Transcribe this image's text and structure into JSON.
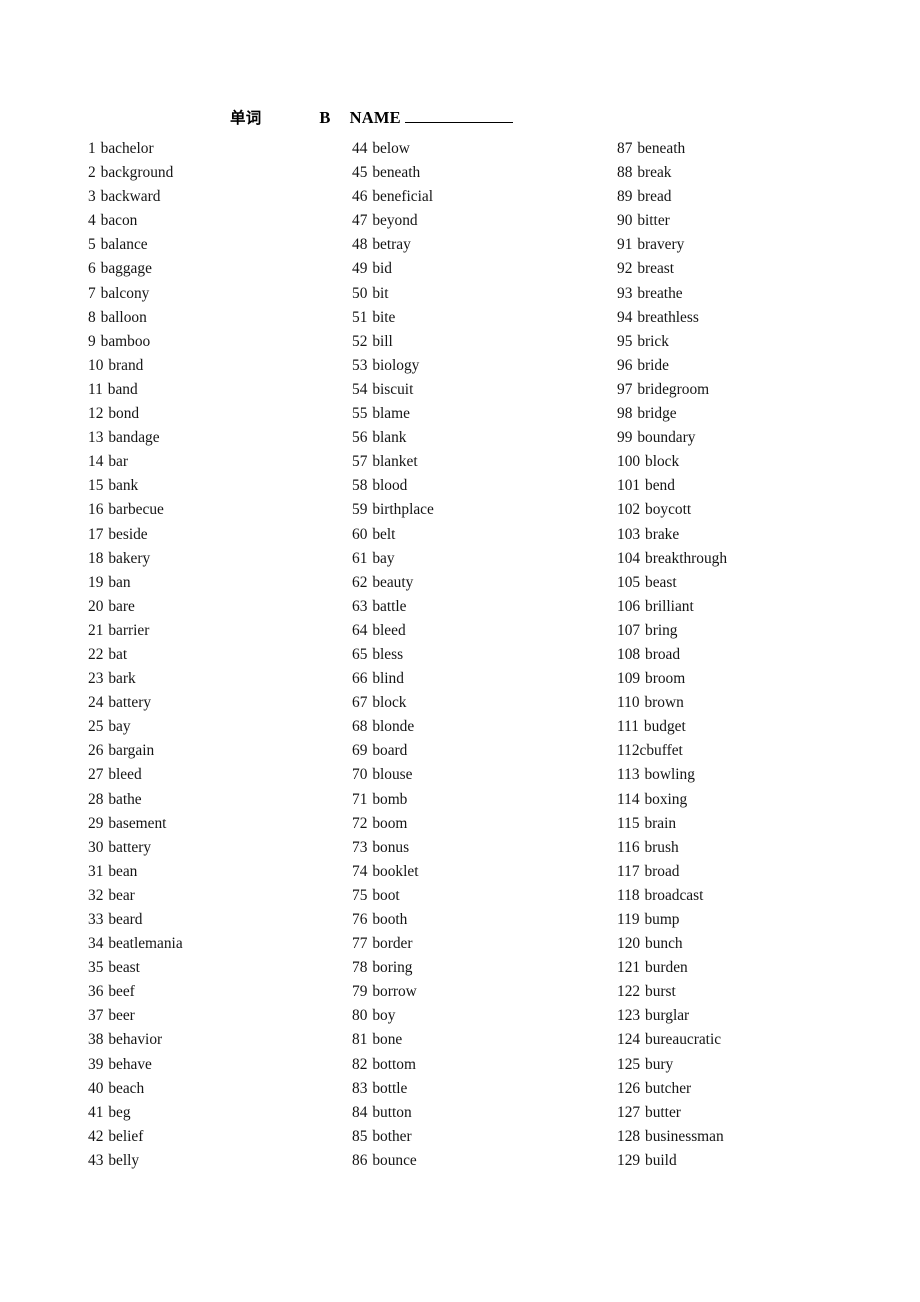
{
  "header": {
    "title_cn": "单词",
    "letter": "B",
    "name_label": "NAME",
    "name_value": ""
  },
  "columns": [
    {
      "name": "column-1",
      "entries": [
        {
          "num": "1",
          "word": "bachelor"
        },
        {
          "num": "2",
          "word": "background"
        },
        {
          "num": "3",
          "word": "backward"
        },
        {
          "num": "4",
          "word": "bacon"
        },
        {
          "num": "5",
          "word": "balance"
        },
        {
          "num": "6",
          "word": "baggage"
        },
        {
          "num": "7",
          "word": "balcony"
        },
        {
          "num": "8",
          "word": "balloon"
        },
        {
          "num": "9",
          "word": "bamboo"
        },
        {
          "num": "10",
          "word": "brand"
        },
        {
          "num": "11",
          "word": "band"
        },
        {
          "num": "12",
          "word": "bond"
        },
        {
          "num": "13",
          "word": "bandage"
        },
        {
          "num": "14",
          "word": "bar"
        },
        {
          "num": "15",
          "word": "bank"
        },
        {
          "num": "16",
          "word": "barbecue"
        },
        {
          "num": "17",
          "word": "beside"
        },
        {
          "num": "18",
          "word": "bakery"
        },
        {
          "num": "19",
          "word": "ban"
        },
        {
          "num": "20",
          "word": "bare"
        },
        {
          "num": "21",
          "word": "barrier"
        },
        {
          "num": "22",
          "word": "bat"
        },
        {
          "num": "23",
          "word": "bark"
        },
        {
          "num": "24",
          "word": "battery"
        },
        {
          "num": "25",
          "word": "bay"
        },
        {
          "num": "26",
          "word": "bargain"
        },
        {
          "num": "27",
          "word": "bleed"
        },
        {
          "num": "28",
          "word": "bathe"
        },
        {
          "num": "29",
          "word": "basement"
        },
        {
          "num": "30",
          "word": "battery"
        },
        {
          "num": "31",
          "word": "bean"
        },
        {
          "num": "32",
          "word": "bear"
        },
        {
          "num": "33",
          "word": "beard"
        },
        {
          "num": "34",
          "word": "beatlemania"
        },
        {
          "num": "35",
          "word": "beast"
        },
        {
          "num": "36",
          "word": "beef"
        },
        {
          "num": "37",
          "word": "beer"
        },
        {
          "num": "38",
          "word": "behavior"
        },
        {
          "num": "39",
          "word": "behave"
        },
        {
          "num": "40",
          "word": "beach"
        },
        {
          "num": "41",
          "word": "beg"
        },
        {
          "num": "42",
          "word": "belief"
        },
        {
          "num": "43",
          "word": "belly"
        }
      ]
    },
    {
      "name": "column-2",
      "entries": [
        {
          "num": "44",
          "word": "below"
        },
        {
          "num": "45",
          "word": "beneath"
        },
        {
          "num": "46",
          "word": "beneficial"
        },
        {
          "num": "47",
          "word": "beyond"
        },
        {
          "num": "48",
          "word": "betray"
        },
        {
          "num": "49",
          "word": "bid"
        },
        {
          "num": "50",
          "word": "bit"
        },
        {
          "num": "51",
          "word": "bite"
        },
        {
          "num": "52",
          "word": "bill"
        },
        {
          "num": "53",
          "word": "biology"
        },
        {
          "num": "54",
          "word": "biscuit"
        },
        {
          "num": "55",
          "word": "blame"
        },
        {
          "num": "56",
          "word": "blank"
        },
        {
          "num": "57",
          "word": "blanket"
        },
        {
          "num": "58",
          "word": "blood"
        },
        {
          "num": "59",
          "word": "birthplace"
        },
        {
          "num": "60",
          "word": "belt"
        },
        {
          "num": "61",
          "word": "bay"
        },
        {
          "num": "62",
          "word": "beauty"
        },
        {
          "num": "63",
          "word": "battle"
        },
        {
          "num": "64",
          "word": "bleed"
        },
        {
          "num": "65",
          "word": "bless"
        },
        {
          "num": "66",
          "word": "blind"
        },
        {
          "num": "67",
          "word": "block"
        },
        {
          "num": "68",
          "word": "blonde"
        },
        {
          "num": "69",
          "word": "board"
        },
        {
          "num": "70",
          "word": "blouse"
        },
        {
          "num": "71",
          "word": "bomb"
        },
        {
          "num": "72",
          "word": "boom"
        },
        {
          "num": "73",
          "word": "bonus"
        },
        {
          "num": "74",
          "word": "booklet"
        },
        {
          "num": "75",
          "word": "boot"
        },
        {
          "num": "76",
          "word": "booth"
        },
        {
          "num": "77",
          "word": "border"
        },
        {
          "num": "78",
          "word": "boring"
        },
        {
          "num": "79",
          "word": "borrow"
        },
        {
          "num": "80",
          "word": "boy"
        },
        {
          "num": "81",
          "word": "bone"
        },
        {
          "num": "82",
          "word": "bottom"
        },
        {
          "num": "83",
          "word": "bottle"
        },
        {
          "num": "84",
          "word": "button"
        },
        {
          "num": "85",
          "word": "bother"
        },
        {
          "num": "86",
          "word": "bounce"
        }
      ]
    },
    {
      "name": "column-3",
      "entries": [
        {
          "num": "87",
          "word": "beneath"
        },
        {
          "num": "88",
          "word": "break"
        },
        {
          "num": "89",
          "word": "bread"
        },
        {
          "num": "90",
          "word": "bitter"
        },
        {
          "num": "91",
          "word": "bravery"
        },
        {
          "num": "92",
          "word": "breast"
        },
        {
          "num": "93",
          "word": "breathe"
        },
        {
          "num": "94",
          "word": "breathless"
        },
        {
          "num": "95",
          "word": "brick"
        },
        {
          "num": "96",
          "word": "bride"
        },
        {
          "num": "97",
          "word": "bridegroom"
        },
        {
          "num": "98",
          "word": "bridge"
        },
        {
          "num": "99",
          "word": "boundary"
        },
        {
          "num": "100",
          "word": "block"
        },
        {
          "num": "101",
          "word": "bend"
        },
        {
          "num": "102",
          "word": "boycott"
        },
        {
          "num": "103",
          "word": "brake"
        },
        {
          "num": "104",
          "word": "breakthrough"
        },
        {
          "num": "105",
          "word": "beast"
        },
        {
          "num": "106",
          "word": "brilliant"
        },
        {
          "num": "107",
          "word": "bring"
        },
        {
          "num": "108",
          "word": "broad"
        },
        {
          "num": "109",
          "word": "broom"
        },
        {
          "num": "110",
          "word": "brown"
        },
        {
          "num": "111",
          "word": "budget"
        },
        {
          "num": "112",
          "word": "cbuffet",
          "no_space": true
        },
        {
          "num": "113",
          "word": "bowling"
        },
        {
          "num": "114",
          "word": "boxing"
        },
        {
          "num": "115",
          "word": "brain"
        },
        {
          "num": "116",
          "word": "brush"
        },
        {
          "num": "117",
          "word": "broad"
        },
        {
          "num": "118",
          "word": "broadcast"
        },
        {
          "num": "119",
          "word": "bump"
        },
        {
          "num": "120",
          "word": "bunch"
        },
        {
          "num": "121",
          "word": "burden"
        },
        {
          "num": "122",
          "word": "burst"
        },
        {
          "num": "123",
          "word": "burglar"
        },
        {
          "num": "124",
          "word": "bureaucratic"
        },
        {
          "num": "125",
          "word": "bury"
        },
        {
          "num": "126",
          "word": "butcher"
        },
        {
          "num": "127",
          "word": "butter"
        },
        {
          "num": "128",
          "word": "businessman"
        },
        {
          "num": "129",
          "word": "build"
        }
      ]
    }
  ]
}
